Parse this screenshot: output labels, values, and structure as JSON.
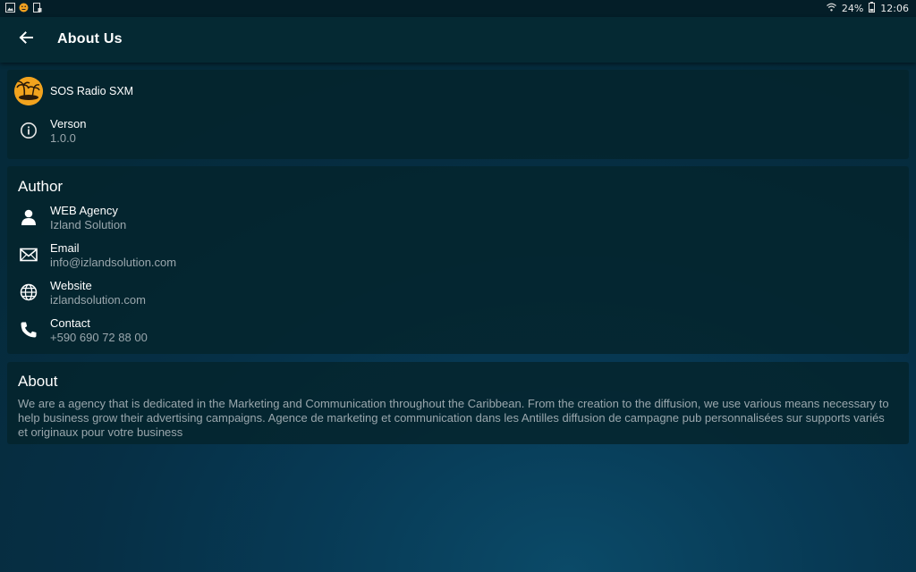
{
  "statusbar": {
    "battery": "24%",
    "time": "12:06",
    "left_icons": [
      "image-icon",
      "emoji-icon",
      "sim-icon"
    ],
    "right_icons": [
      "wifi-icon",
      "battery-icon"
    ]
  },
  "appbar": {
    "title": "About Us",
    "back_icon": "arrow-left-icon"
  },
  "app_info": {
    "name": "SOS Radio SXM",
    "version_label": "Verson",
    "version_value": "1.0.0"
  },
  "author": {
    "title": "Author",
    "items": [
      {
        "icon": "person-icon",
        "label": "WEB Agency",
        "value": "Izland Solution"
      },
      {
        "icon": "mail-icon",
        "label": "Email",
        "value": "info@izlandsolution.com"
      },
      {
        "icon": "globe-icon",
        "label": "Website",
        "value": "izlandsolution.com"
      },
      {
        "icon": "phone-icon",
        "label": "Contact",
        "value": "+590 690 72 88 00"
      }
    ]
  },
  "about": {
    "title": "About",
    "text": "We are a agency that is dedicated in the Marketing and Communication throughout the Caribbean. From the creation to the diffusion, we use various means necessary to help business grow their advertising campaigns. Agence de marketing et communication dans les Antilles diffusion de campagne pub personnalisées sur supports variés et originaux pour votre business"
  },
  "colors": {
    "background": "#062f45",
    "card": "#05252d",
    "secondary_text": "#9aa7ad",
    "logo_accent": "#f2a31e"
  }
}
